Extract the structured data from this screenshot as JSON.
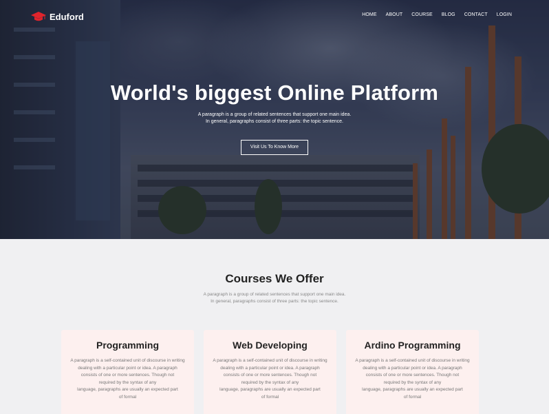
{
  "nav": {
    "brand": "Eduford",
    "brand_icon": "graduation-cap-icon",
    "brand_color": "#e0242c",
    "items": [
      "HOME",
      "ABOUT",
      "COURSE",
      "BLOG",
      "CONTACT",
      "LOGIN"
    ]
  },
  "hero": {
    "title": "World's biggest Online Platform",
    "subtitle_line1": "A paragraph is a group of related sentences that support one main idea.",
    "subtitle_line2": "In general, paragraphs consist of three parts: the topic sentence.",
    "button_label": "Visit Us To Know More"
  },
  "courses": {
    "title": "Courses We Offer",
    "subtitle_line1": "A paragraph is a group of related sentences that support one main idea.",
    "subtitle_line2": "In general, paragraphs consist of three parts: the topic sentence.",
    "cards": [
      {
        "title": "Programming",
        "lines": [
          "A paragraph is a self-contained unit of discourse in writing",
          "dealing with a particular point or idea. A paragraph",
          "consists of one or more sentences. Though not",
          "required by the syntax of any",
          "language, paragraphs are usually an expected part",
          "of formal"
        ]
      },
      {
        "title": "Web Developing",
        "lines": [
          "A paragraph is a self-contained unit of discourse in writing",
          "dealing with a particular point or idea. A paragraph",
          "consists of one or more sentences. Though not",
          "required by the syntax of any",
          "language, paragraphs are usually an expected part",
          "of formal"
        ]
      },
      {
        "title": "Ardino Programming",
        "lines": [
          "A paragraph is a self-contained unit of discourse in writing",
          "dealing with a particular point or idea. A paragraph",
          "consists of one or more sentences. Though not",
          "required by the syntax of any",
          "language, paragraphs are usually an expected part",
          "of formal"
        ]
      }
    ],
    "card_background": "#fdf0ef"
  }
}
